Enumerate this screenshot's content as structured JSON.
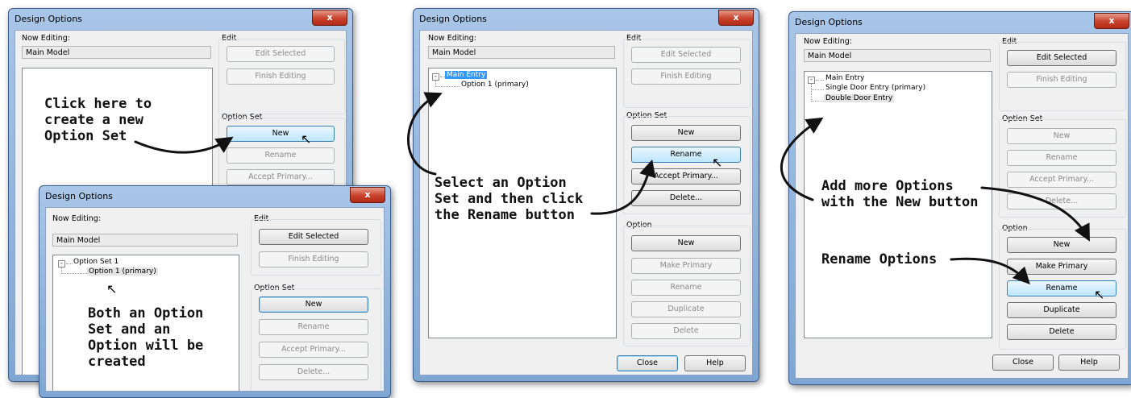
{
  "panel1": {
    "title": "Design Options",
    "close": "x",
    "now_editing_label": "Now Editing:",
    "now_editing_value": "Main Model",
    "edit_label": "Edit",
    "edit_selected": "Edit Selected",
    "finish_editing": "Finish Editing",
    "option_set_label": "Option Set",
    "new": "New",
    "rename": "Rename",
    "accept_primary": "Accept Primary...",
    "annotation": "Click here to\ncreate a new\nOption Set"
  },
  "panel1b": {
    "title": "Design Options",
    "close": "x",
    "now_editing_label": "Now Editing:",
    "now_editing_value": "Main Model",
    "edit_label": "Edit",
    "edit_selected": "Edit Selected",
    "finish_editing": "Finish Editing",
    "tree_root": "Option Set 1",
    "tree_child": "Option 1 (primary)",
    "option_set_label": "Option Set",
    "new": "New",
    "rename": "Rename",
    "accept_primary": "Accept Primary...",
    "delete": "Delete...",
    "annotation": "Both an Option\nSet and an\nOption will be\ncreated"
  },
  "panel2": {
    "title": "Design Options",
    "close": "x",
    "now_editing_label": "Now Editing:",
    "now_editing_value": "Main Model",
    "edit_label": "Edit",
    "edit_selected": "Edit Selected",
    "finish_editing": "Finish Editing",
    "tree_root": "Main Entry",
    "tree_child": "Option 1 (primary)",
    "option_set_label": "Option Set",
    "set_new": "New",
    "set_rename": "Rename",
    "set_accept_primary": "Accept Primary...",
    "set_delete": "Delete...",
    "option_label": "Option",
    "opt_new": "New",
    "opt_make_primary": "Make Primary",
    "opt_rename": "Rename",
    "opt_duplicate": "Duplicate",
    "opt_delete": "Delete",
    "close_button": "Close",
    "help_button": "Help",
    "annotation": "Select an Option\nSet and then click\nthe Rename button"
  },
  "panel3": {
    "title": "Design Options",
    "close": "x",
    "now_editing_label": "Now Editing:",
    "now_editing_value": "Main Model",
    "edit_label": "Edit",
    "edit_selected": "Edit Selected",
    "finish_editing": "Finish Editing",
    "tree_root": "Main Entry",
    "tree_child1": "Single Door Entry (primary)",
    "tree_child2": "Double Door Entry",
    "option_set_label": "Option Set",
    "set_new": "New",
    "set_rename": "Rename",
    "set_accept_primary": "Accept Primary...",
    "set_delete": "Delete...",
    "option_label": "Option",
    "opt_new": "New",
    "opt_make_primary": "Make Primary",
    "opt_rename": "Rename",
    "opt_duplicate": "Duplicate",
    "opt_delete": "Delete",
    "close_button": "Close",
    "help_button": "Help",
    "annotation1": "Add more Options\nwith the New button",
    "annotation2": "Rename Options"
  },
  "colors": {
    "selection": "#3399ff",
    "hot_button": "#bee6fd",
    "title_gradient": "#a9c6e8",
    "close_button": "#c9412b"
  },
  "icons": {
    "cursor": "arrow-pointer-icon",
    "expander": "tree-collapse-icon"
  }
}
